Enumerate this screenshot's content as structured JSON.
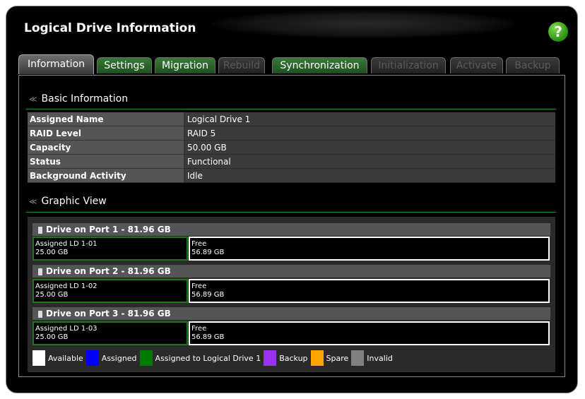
{
  "window": {
    "title": "Logical Drive Information",
    "help_label": "?"
  },
  "tabs": [
    {
      "label": "Information",
      "state": "active"
    },
    {
      "label": "Settings",
      "state": "enabled"
    },
    {
      "label": "Migration",
      "state": "enabled"
    },
    {
      "label": "Rebuild",
      "state": "disabled"
    },
    {
      "label": "Synchronization",
      "state": "enabled"
    },
    {
      "label": "Initialization",
      "state": "disabled"
    },
    {
      "label": "Activate",
      "state": "disabled"
    },
    {
      "label": "Backup",
      "state": "disabled"
    }
  ],
  "basic_info": {
    "heading": "Basic Information",
    "rows": [
      {
        "label": "Assigned Name",
        "value": "Logical Drive 1"
      },
      {
        "label": "RAID Level",
        "value": "RAID 5"
      },
      {
        "label": "Capacity",
        "value": "50.00 GB"
      },
      {
        "label": "Status",
        "value": "Functional"
      },
      {
        "label": "Background Activity",
        "value": "Idle"
      }
    ]
  },
  "graphic_view": {
    "heading": "Graphic View",
    "drives": [
      {
        "title": "Drive on Port 1 - 81.96 GB",
        "assigned_label": "Assigned LD 1-01",
        "assigned_size": "25.00 GB",
        "free_label": "Free",
        "free_size": "56.89 GB"
      },
      {
        "title": "Drive on Port 2 - 81.96 GB",
        "assigned_label": "Assigned LD 1-02",
        "assigned_size": "25.00 GB",
        "free_label": "Free",
        "free_size": "56.89 GB"
      },
      {
        "title": "Drive on Port 3 - 81.96 GB",
        "assigned_label": "Assigned LD 1-03",
        "assigned_size": "25.00 GB",
        "free_label": "Free",
        "free_size": "56.89 GB"
      }
    ],
    "legend": [
      {
        "label": "Available",
        "color": "#ffffff"
      },
      {
        "label": "Assigned",
        "color": "#0000ff"
      },
      {
        "label": "Assigned to Logical Drive 1",
        "color": "#007a00"
      },
      {
        "label": "Backup",
        "color": "#9933ee"
      },
      {
        "label": "Spare",
        "color": "#ffa500"
      },
      {
        "label": "Invalid",
        "color": "#808080"
      }
    ]
  }
}
